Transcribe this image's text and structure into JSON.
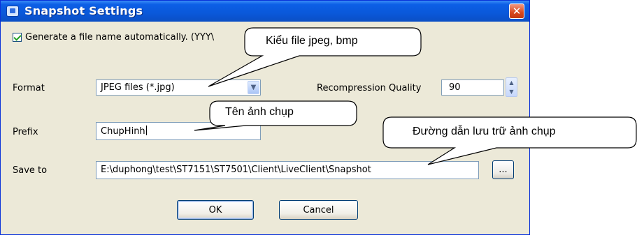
{
  "window": {
    "title": "Snapshot Settings",
    "close_label": "✕"
  },
  "auto_name": {
    "checked": true,
    "label": "Generate a file name automatically. (YYY\\"
  },
  "format": {
    "label": "Format",
    "selected": "JPEG files (*.jpg)"
  },
  "quality": {
    "label": "Recompression Quality",
    "value": "90"
  },
  "prefix": {
    "label": "Prefix",
    "value": "ChupHinh"
  },
  "save_to": {
    "label": "Save to",
    "value": "E:\\duphong\\test\\ST7151\\ST7501\\Client\\LiveClient\\Snapshot",
    "browse_label": "..."
  },
  "buttons": {
    "ok": "OK",
    "cancel": "Cancel"
  },
  "callouts": {
    "file_type": "Kiểu file jpeg, bmp",
    "image_name": "Tên ảnh chụp",
    "save_path": "Đường dẫn lưu trữ ảnh chụp"
  },
  "icons": {
    "title": "snapshot-camera-icon",
    "close": "close-icon",
    "checkbox": "checkmark-icon",
    "combo": "chevron-down-icon",
    "spin_up": "spin-up-arrow-icon",
    "spin_down": "spin-down-arrow-icon"
  }
}
